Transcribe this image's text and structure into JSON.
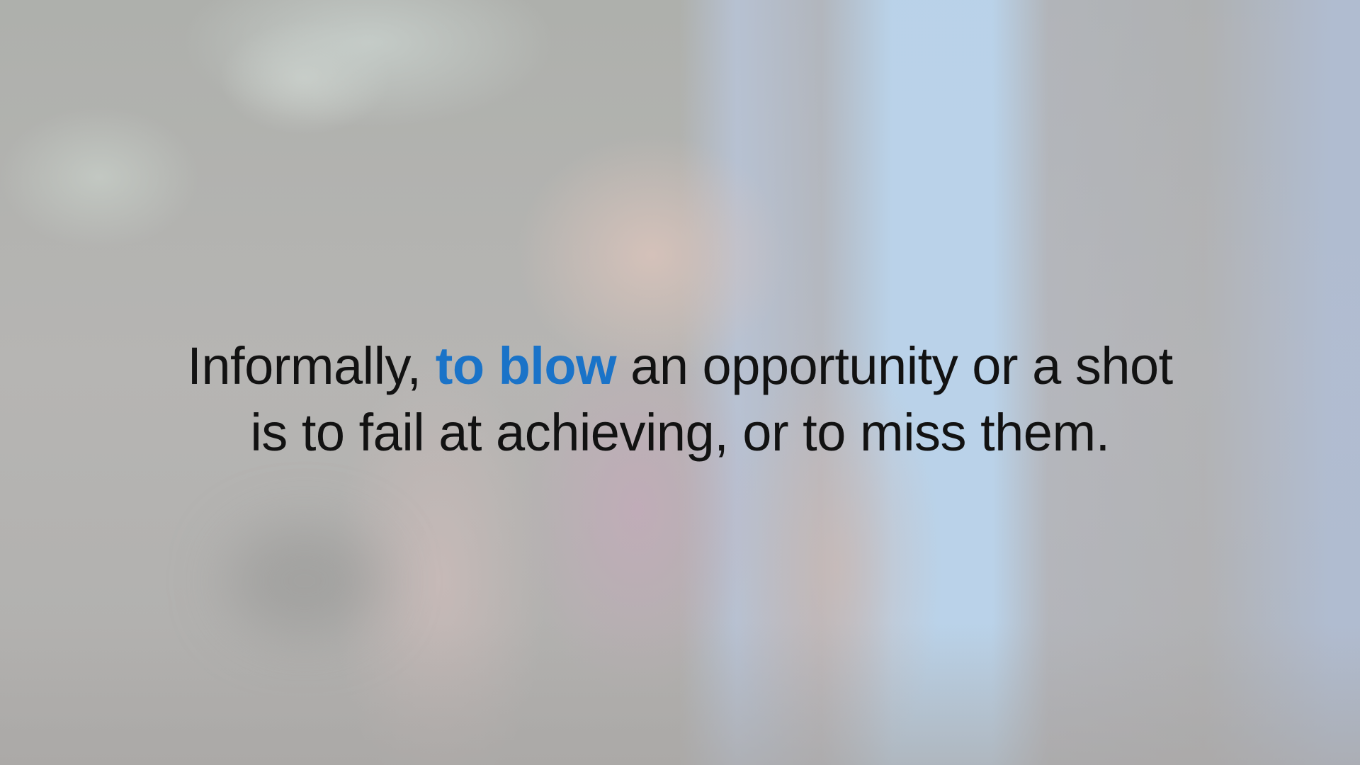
{
  "caption": {
    "line1_before": "Informally, ",
    "line1_highlight": "to blow",
    "line1_after": " an opportunity or a shot",
    "line2": "is to fail at achieving, or to miss them."
  },
  "colors": {
    "text": "#121212",
    "highlight": "#1a73c8",
    "background": "#b3b1af"
  }
}
